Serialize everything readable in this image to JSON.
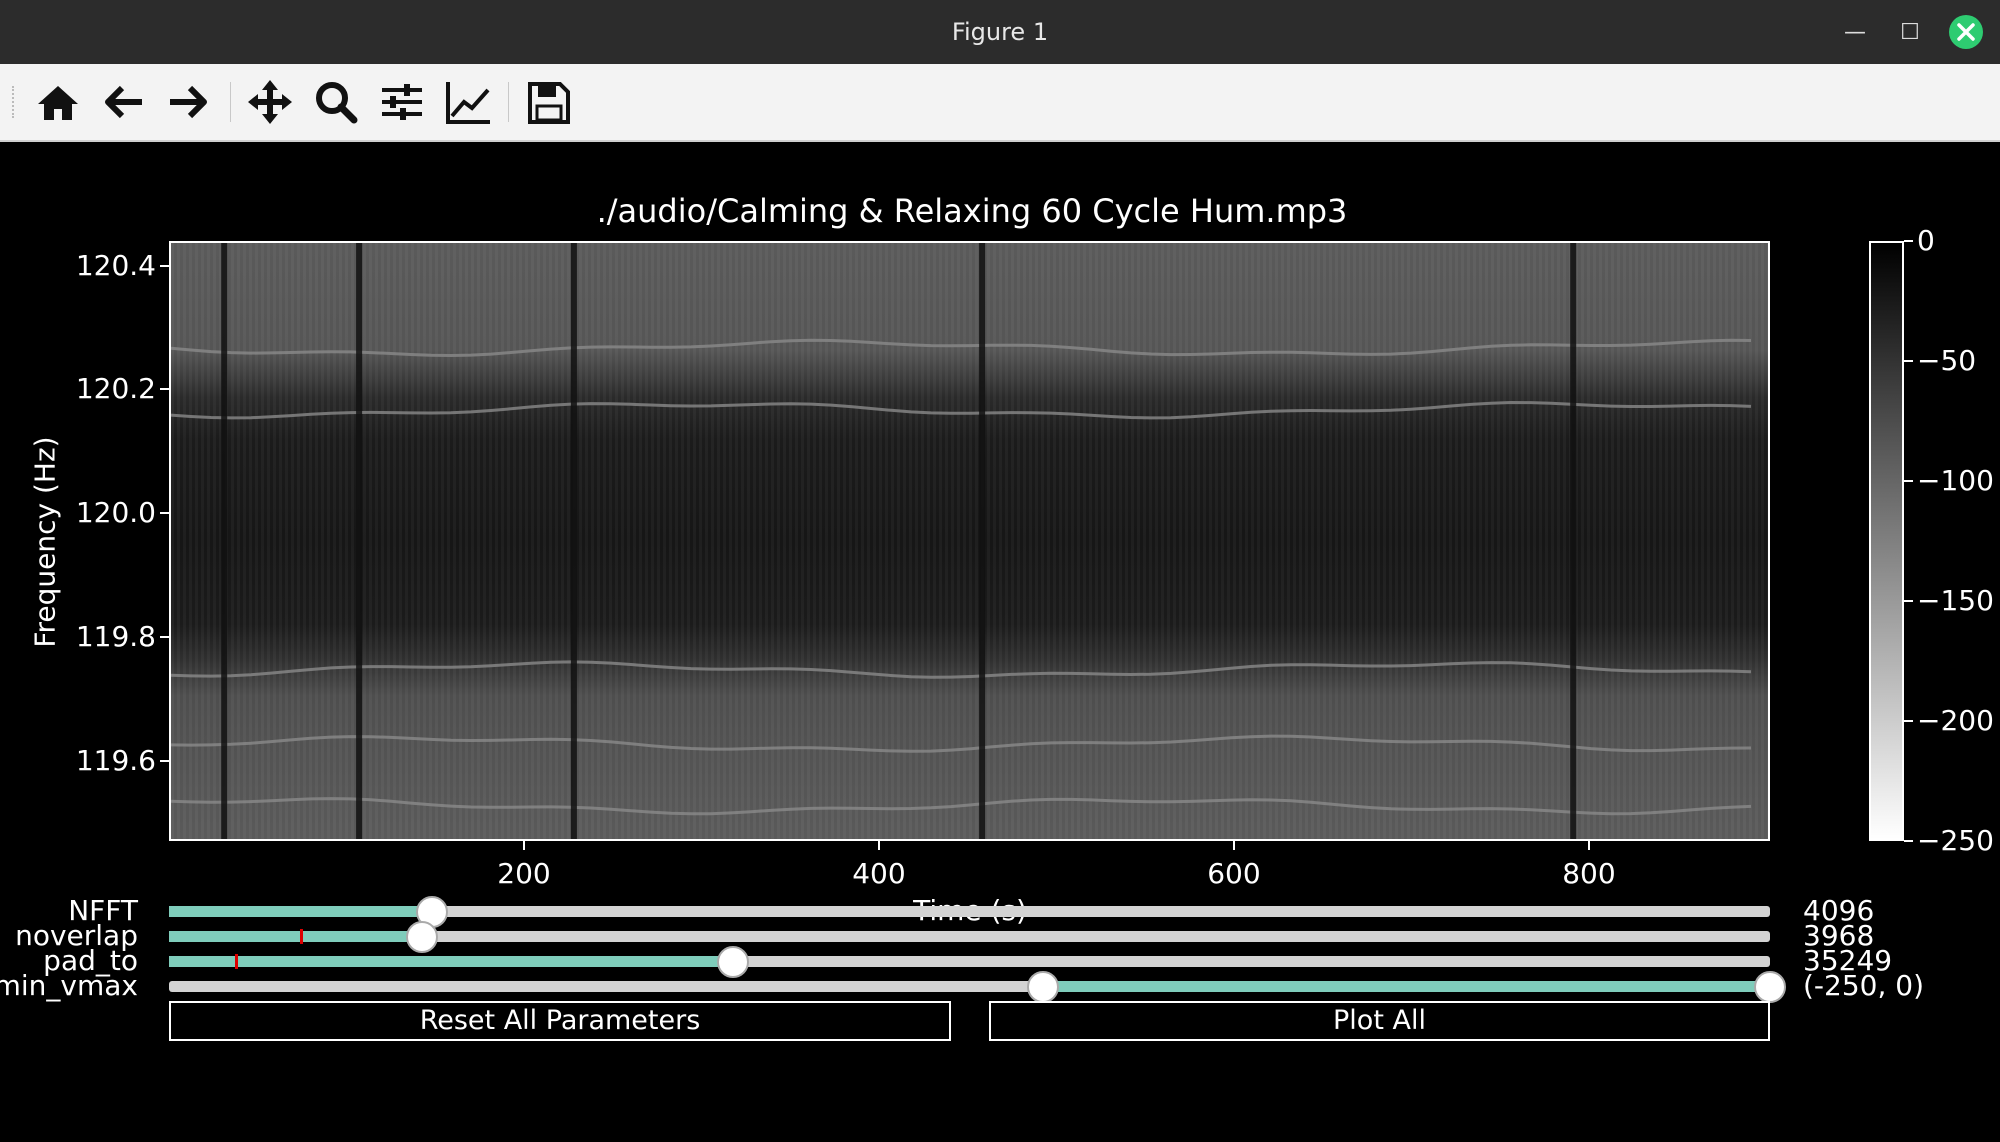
{
  "window": {
    "title": "Figure 1"
  },
  "toolbar": {
    "icons": [
      "home-icon",
      "back-arrow-icon",
      "forward-arrow-icon",
      "pan-icon",
      "zoom-icon",
      "configure-subplots-icon",
      "edit-axis-icon",
      "save-icon"
    ]
  },
  "plot": {
    "title": "./audio/Calming & Relaxing 60 Cycle Hum.mp3",
    "xlabel": "Time (s)",
    "ylabel": "Frequency (Hz)",
    "xticks": [
      "200",
      "400",
      "600",
      "800"
    ],
    "yticks": [
      "120.4",
      "120.2",
      "120.0",
      "119.8",
      "119.6"
    ],
    "colorbar_ticks": [
      "0",
      "−50",
      "−100",
      "−150",
      "−200",
      "−250"
    ]
  },
  "chart_data": {
    "type": "heatmap",
    "title": "./audio/Calming & Relaxing 60 Cycle Hum.mp3",
    "xlabel": "Time (s)",
    "ylabel": "Frequency (Hz)",
    "xlim": [
      0,
      902
    ],
    "ylim": [
      119.47,
      120.44
    ],
    "xticks": [
      200,
      400,
      600,
      800
    ],
    "yticks": [
      120.4,
      120.2,
      120.0,
      119.8,
      119.6
    ],
    "colorbar": {
      "range": [
        -250,
        0
      ],
      "ticks": [
        0,
        -50,
        -100,
        -150,
        -200,
        -250
      ],
      "colormap": "gray_r"
    },
    "bright_bands_hz": [
      120.27,
      120.17,
      119.75,
      119.63,
      119.53
    ],
    "dark_vertical_lines_s": [
      30,
      106,
      227,
      457,
      790
    ]
  },
  "sliders": [
    {
      "label": "NFFT",
      "value": "4096",
      "fill_start": 0.0,
      "fill_end": 0.164,
      "knob": 0.164,
      "marker": null
    },
    {
      "label": "noverlap",
      "value": "3968",
      "fill_start": 0.0,
      "fill_end": 0.158,
      "knob": 0.158,
      "marker": 0.082
    },
    {
      "label": "pad_to",
      "value": "35249",
      "fill_start": 0.0,
      "fill_end": 0.352,
      "knob": 0.352,
      "marker": 0.041
    },
    {
      "label": "min_vmax",
      "value": "(-250, 0)",
      "fill_start": 0.546,
      "fill_end": 1.0,
      "knob": 0.546,
      "knob2": 1.0,
      "marker": null
    }
  ],
  "buttons": {
    "reset": "Reset All Parameters",
    "plot_all": "Plot All"
  }
}
